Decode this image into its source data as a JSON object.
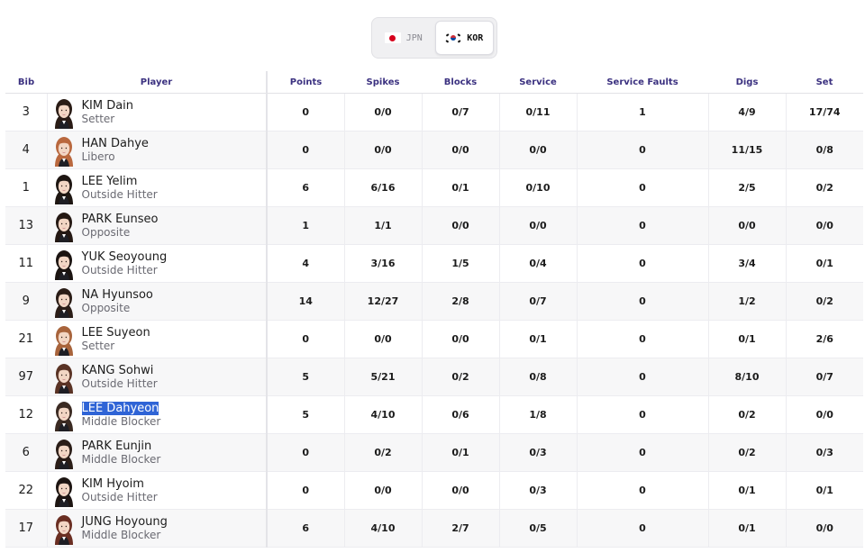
{
  "teams": [
    {
      "code": "JPN",
      "flag": "japan-flag-icon",
      "active": false
    },
    {
      "code": "KOR",
      "flag": "korea-flag-icon",
      "active": true
    }
  ],
  "columns": [
    "Bib",
    "Player",
    "Points",
    "Spikes",
    "Blocks",
    "Service",
    "Service Faults",
    "Digs",
    "Set"
  ],
  "rows": [
    {
      "bib": "3",
      "name": "KIM Dain",
      "position": "Setter",
      "points": "0",
      "spikes": "0/0",
      "blocks": "0/7",
      "service": "0/11",
      "service_faults": "1",
      "digs": "4/9",
      "set": "17/74",
      "hair": "#2a1c16"
    },
    {
      "bib": "4",
      "name": "HAN Dahye",
      "position": "Libero",
      "points": "0",
      "spikes": "0/0",
      "blocks": "0/0",
      "service": "0/0",
      "service_faults": "0",
      "digs": "11/15",
      "set": "0/8",
      "hair": "#b9683e"
    },
    {
      "bib": "1",
      "name": "LEE Yelim",
      "position": "Outside Hitter",
      "points": "6",
      "spikes": "6/16",
      "blocks": "0/1",
      "service": "0/10",
      "service_faults": "0",
      "digs": "2/5",
      "set": "0/2",
      "hair": "#1e1612"
    },
    {
      "bib": "13",
      "name": "PARK Eunseo",
      "position": "Opposite",
      "points": "1",
      "spikes": "1/1",
      "blocks": "0/0",
      "service": "0/0",
      "service_faults": "0",
      "digs": "0/0",
      "set": "0/0",
      "hair": "#241813"
    },
    {
      "bib": "11",
      "name": "YUK Seoyoung",
      "position": "Outside Hitter",
      "points": "4",
      "spikes": "3/16",
      "blocks": "1/5",
      "service": "0/4",
      "service_faults": "0",
      "digs": "3/4",
      "set": "0/1",
      "hair": "#1b1411"
    },
    {
      "bib": "9",
      "name": "NA Hyunsoo",
      "position": "Opposite",
      "points": "14",
      "spikes": "12/27",
      "blocks": "2/8",
      "service": "0/7",
      "service_faults": "0",
      "digs": "1/2",
      "set": "0/2",
      "hair": "#2b1d17"
    },
    {
      "bib": "21",
      "name": "LEE Suyeon",
      "position": "Setter",
      "points": "0",
      "spikes": "0/0",
      "blocks": "0/0",
      "service": "0/1",
      "service_faults": "0",
      "digs": "0/1",
      "set": "2/6",
      "hair": "#a8643c"
    },
    {
      "bib": "97",
      "name": "KANG Sohwi",
      "position": "Outside Hitter",
      "points": "5",
      "spikes": "5/21",
      "blocks": "0/2",
      "service": "0/8",
      "service_faults": "0",
      "digs": "8/10",
      "set": "0/7",
      "hair": "#5a3325"
    },
    {
      "bib": "12",
      "name": "LEE Dahyeon",
      "position": "Middle Blocker",
      "points": "5",
      "spikes": "4/10",
      "blocks": "0/6",
      "service": "1/8",
      "service_faults": "0",
      "digs": "0/2",
      "set": "0/0",
      "hair": "#3a2a22",
      "selected": true
    },
    {
      "bib": "6",
      "name": "PARK Eunjin",
      "position": "Middle Blocker",
      "points": "0",
      "spikes": "0/2",
      "blocks": "0/1",
      "service": "0/3",
      "service_faults": "0",
      "digs": "0/2",
      "set": "0/3",
      "hair": "#2a1d17"
    },
    {
      "bib": "22",
      "name": "KIM Hyoim",
      "position": "Outside Hitter",
      "points": "0",
      "spikes": "0/0",
      "blocks": "0/0",
      "service": "0/3",
      "service_faults": "0",
      "digs": "0/1",
      "set": "0/1",
      "hair": "#1d1512"
    },
    {
      "bib": "17",
      "name": "JUNG Hoyoung",
      "position": "Middle Blocker",
      "points": "6",
      "spikes": "4/10",
      "blocks": "2/7",
      "service": "0/5",
      "service_faults": "0",
      "digs": "0/1",
      "set": "0/0",
      "hair": "#6a2e22"
    }
  ],
  "colors": {
    "header_text": "#3b3180",
    "selection": "#2f64d6",
    "row_alt": "#f7f7f8"
  }
}
